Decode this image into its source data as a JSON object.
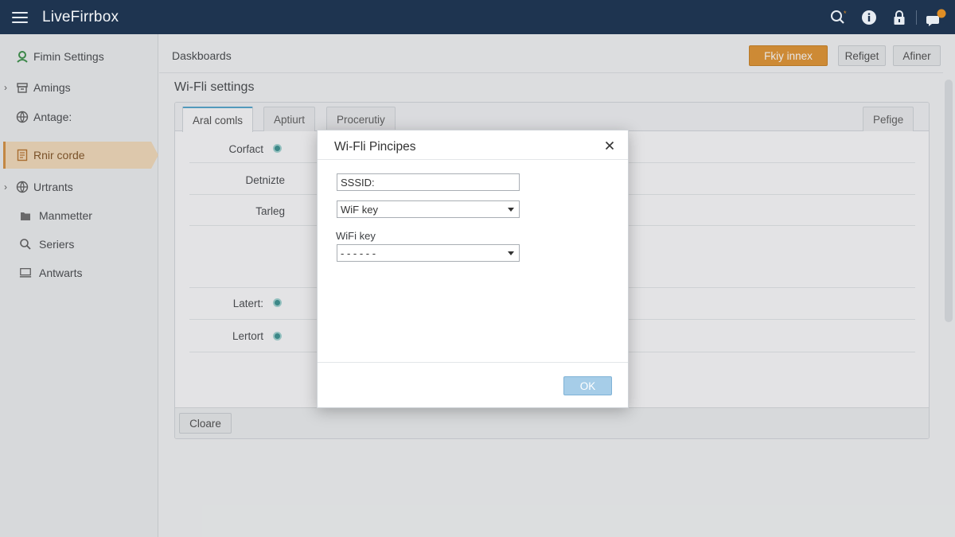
{
  "app": {
    "title": "LiveFirrbox"
  },
  "topbar": {
    "icons": [
      "search-icon",
      "info-icon",
      "lock-icon",
      "notifications-icon"
    ],
    "accent": "#e08e25",
    "bg": "#1e3450"
  },
  "sidebar": {
    "items": [
      {
        "label": "Fimin Settings",
        "icon": "settings-icon"
      },
      {
        "label": "Amings",
        "icon": "archive-icon"
      },
      {
        "label": "Antage:",
        "icon": "globe-icon"
      },
      {
        "label": "Rnir corde",
        "icon": "document-icon"
      },
      {
        "label": "Urtrants",
        "icon": "globe-icon"
      },
      {
        "label": "Manmetter",
        "icon": "folder-icon"
      },
      {
        "label": "Seriers",
        "icon": "search-icon"
      },
      {
        "label": "Antwarts",
        "icon": "monitor-icon"
      }
    ]
  },
  "header": {
    "breadcrumb": "Daskboards",
    "buttons": {
      "primary": "Fkiy innex",
      "second": "Refiget",
      "third": "Afiner"
    }
  },
  "section": {
    "title": "Wi-Fli settings"
  },
  "panel": {
    "tabs": [
      "Aral comls",
      "Aptiurt",
      "Procerutiy"
    ],
    "right_button": "Pefige",
    "rows": [
      {
        "label": "Corfact"
      },
      {
        "label": "Detnizte"
      },
      {
        "label": "Tarleg"
      },
      {
        "label": "Latert:"
      },
      {
        "label": "Lertort"
      }
    ],
    "footer_button": "Cloare"
  },
  "dialog": {
    "title": "Wi-Fli Pincipes",
    "ssid_value": "SSSID:",
    "key_type_value": "WiF key",
    "wifi_key_label": "WiFi key",
    "wifi_key_value": "- - - - - -",
    "ok_label": "OK"
  }
}
